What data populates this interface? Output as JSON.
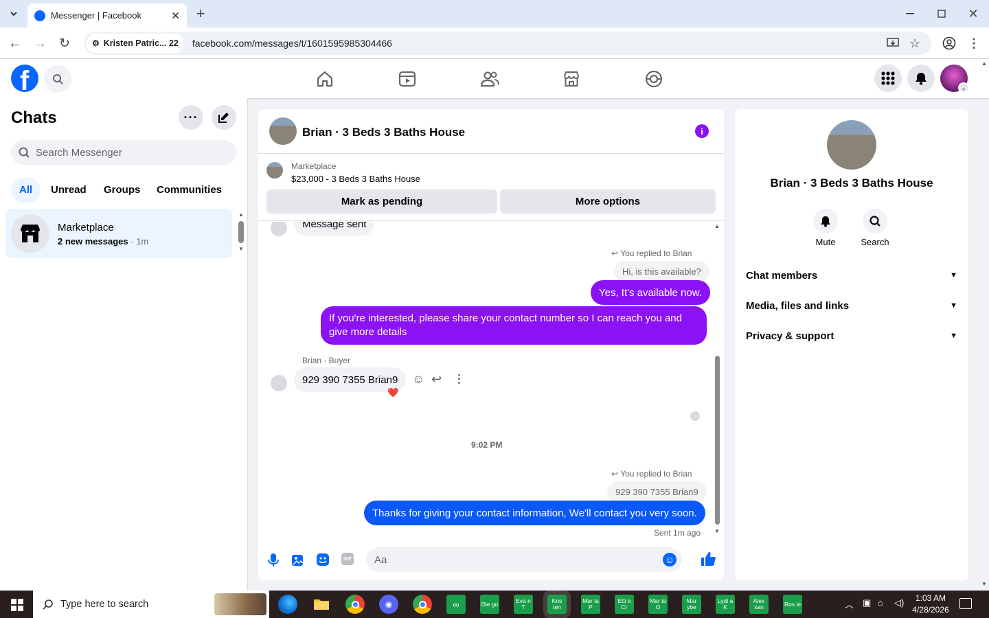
{
  "browser": {
    "tab_title": "Messenger | Facebook",
    "profile_chip": "Kristen Patric... 22",
    "url": "facebook.com/messages/t/1601595985304466"
  },
  "sidebar": {
    "title": "Chats",
    "search_placeholder": "Search Messenger",
    "filters": [
      "All",
      "Unread",
      "Groups",
      "Communities"
    ],
    "chats": [
      {
        "name": "Marketplace",
        "preview": "2 new messages",
        "time": "· 1m"
      }
    ]
  },
  "conversation": {
    "title": "Brian · 3 Beds 3 Baths House",
    "marketplace_label": "Marketplace",
    "listing": "$23,000 - 3 Beds 3 Baths House",
    "mark_pending": "Mark as pending",
    "more_options": "More options",
    "messages": {
      "clipped": "Message sent",
      "replied1": "You replied to Brian",
      "quoted1": "Hi, is this available?",
      "msg1": "Yes, It's available now.",
      "msg2": "If you're interested, please share your contact number so I can reach you and give more details",
      "sender": "Brian · Buyer",
      "buyer_msg": "929 390 7355  Brian9",
      "reaction": "❤️",
      "timestamp": "9:02 PM",
      "replied2": "You replied to Brian",
      "quoted2": "929 390 7355  Brian9",
      "msg3": "Thanks for giving your contact information, We'll contact you very soon.",
      "sent_status": "Sent 1m ago"
    },
    "composer_placeholder": "Aa"
  },
  "details": {
    "name": "Brian · 3 Beds 3 Baths House",
    "mute": "Mute",
    "search": "Search",
    "sections": [
      "Chat members",
      "Media, files and links",
      "Privacy & support"
    ]
  },
  "taskbar": {
    "search_placeholder": "Type here to search",
    "apps": [
      "Die go",
      "Eva n T",
      "Kris ten",
      "Mar la P",
      "Etti e Cr",
      "Mar la O",
      "Mar ybe",
      "Lydi a K",
      "Alex xan",
      "Ros ie"
    ],
    "time": "1:03 AM",
    "date": "4/28/2026"
  },
  "colors": {
    "brand": "#0866ff",
    "purple": "#8a12f5",
    "blue": "#0a58f5"
  }
}
